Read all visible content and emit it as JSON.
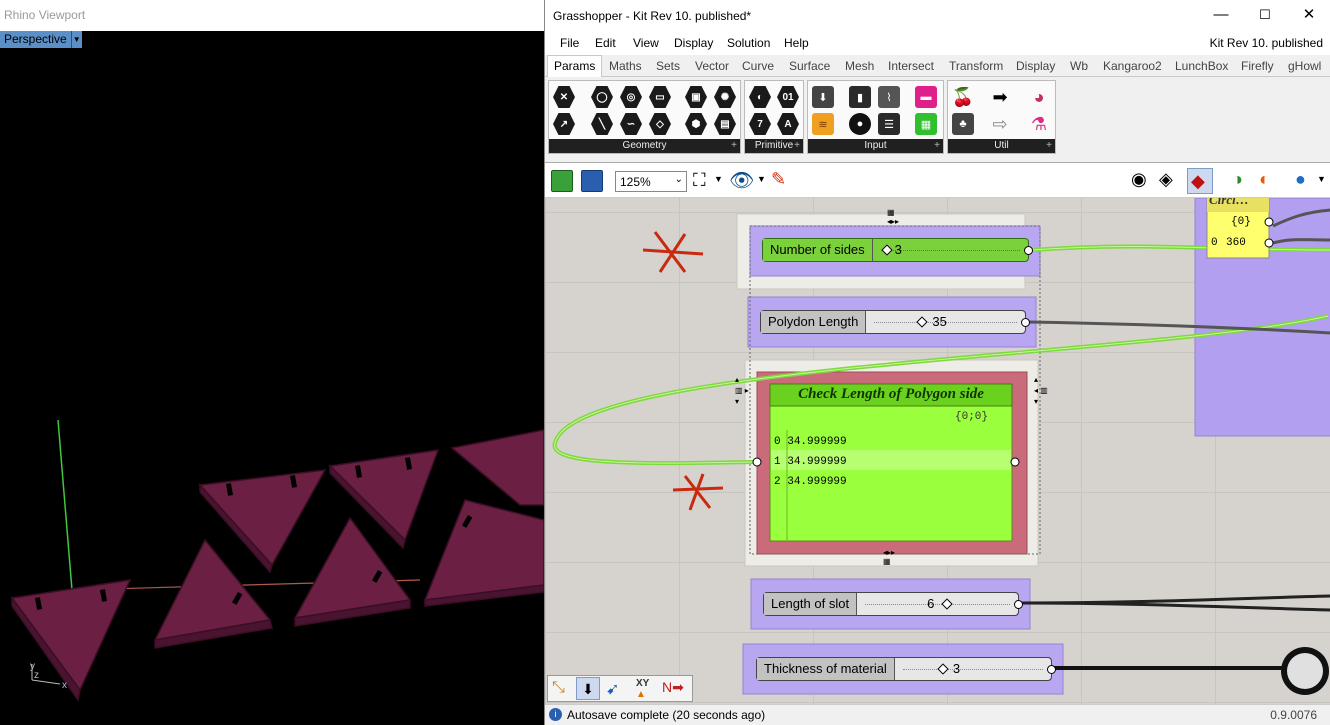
{
  "rhino": {
    "title": "Rhino Viewport",
    "viewport_name": "Perspective",
    "axis_y": "y",
    "axis_z": "z",
    "axis_x": "x"
  },
  "grasshopper": {
    "title": "Grasshopper - Kit Rev 10. published*",
    "doc_name": "Kit Rev 10. published",
    "menu": [
      "File",
      "Edit",
      "View",
      "Display",
      "Solution",
      "Help"
    ],
    "tabs": [
      "Params",
      "Maths",
      "Sets",
      "Vector",
      "Curve",
      "Surface",
      "Mesh",
      "Intersect",
      "Transform",
      "Display",
      "Wb",
      "Kangaroo2",
      "LunchBox",
      "Firefly",
      "gHowl"
    ],
    "active_tab": "Params",
    "ribbon_panels": [
      "Geometry",
      "Primitive",
      "Input",
      "Util"
    ],
    "zoom": "125%",
    "status": "Autosave complete (20 seconds ago)",
    "version": "0.9.0076"
  },
  "canvas": {
    "circle_node": {
      "title": "Circl…",
      "path": "{0}",
      "index": "0",
      "value": "360"
    },
    "sliders": [
      {
        "name": "Number of sides",
        "value": "3"
      },
      {
        "name": "Polydon Length",
        "value": "35"
      },
      {
        "name": "Length of slot",
        "value": "6"
      },
      {
        "name": "Thickness of material",
        "value": "3"
      }
    ],
    "panel": {
      "title": "Check Length of Polygon side",
      "path": "{0;0}",
      "rows": [
        {
          "index": "0",
          "value": "34.999999"
        },
        {
          "index": "1",
          "value": "34.999999"
        },
        {
          "index": "2",
          "value": "34.999999"
        }
      ]
    }
  },
  "colors": {
    "piece": "#6a1f43",
    "slider_selected": "#7bd13c",
    "panel_green": "#9aff3c",
    "group_purple": "#b9a6f0",
    "group_red": "#c96b7a"
  }
}
